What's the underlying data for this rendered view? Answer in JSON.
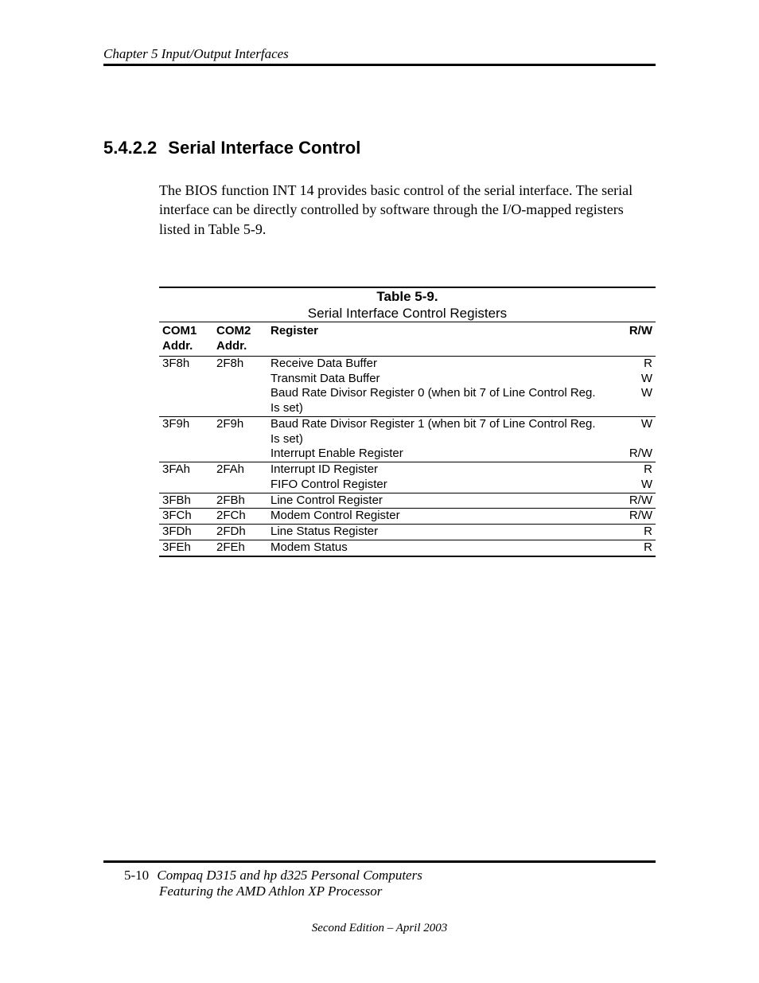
{
  "header": {
    "running": "Chapter 5  Input/Output Interfaces"
  },
  "section": {
    "number": "5.4.2.2",
    "title": "Serial Interface Control",
    "para": "The BIOS function INT 14 provides basic control of the serial interface. The serial interface can be directly controlled by software through the I/O-mapped registers listed in Table 5-9."
  },
  "table": {
    "label": "Table 5-9.",
    "caption": "Serial Interface Control Registers",
    "headers": {
      "com1": "COM1 Addr.",
      "com2": "COM2 Addr.",
      "reg": "Register",
      "rw": "R/W"
    },
    "groups": [
      {
        "com1": "3F8h",
        "com2": "2F8h",
        "rows": [
          {
            "reg": "Receive Data Buffer",
            "rw": "R"
          },
          {
            "reg": "Transmit Data Buffer",
            "rw": "W"
          },
          {
            "reg": "Baud Rate Divisor Register 0 (when bit 7 of Line Control Reg. Is set)",
            "rw": "W"
          }
        ]
      },
      {
        "com1": "3F9h",
        "com2": "2F9h",
        "rows": [
          {
            "reg": "Baud Rate Divisor Register 1 (when bit 7 of Line Control Reg. Is set)",
            "rw": "W"
          },
          {
            "reg": "Interrupt Enable Register",
            "rw": "R/W"
          }
        ]
      },
      {
        "com1": "3FAh",
        "com2": "2FAh",
        "rows": [
          {
            "reg": "Interrupt ID Register",
            "rw": "R"
          },
          {
            "reg": "FIFO Control Register",
            "rw": "W"
          }
        ]
      },
      {
        "com1": "3FBh",
        "com2": "2FBh",
        "rows": [
          {
            "reg": "Line Control Register",
            "rw": "R/W"
          }
        ]
      },
      {
        "com1": "3FCh",
        "com2": "2FCh",
        "rows": [
          {
            "reg": "Modem Control Register",
            "rw": "R/W"
          }
        ]
      },
      {
        "com1": "3FDh",
        "com2": "2FDh",
        "rows": [
          {
            "reg": "Line Status Register",
            "rw": "R"
          }
        ]
      },
      {
        "com1": "3FEh",
        "com2": "2FEh",
        "rows": [
          {
            "reg": "Modem Status",
            "rw": "R"
          }
        ]
      }
    ]
  },
  "footer": {
    "pageno": "5-10",
    "title1": "Compaq D315 and hp d325 Personal Computers",
    "title2": "Featuring the AMD Athlon XP Processor",
    "edition": "Second Edition – April 2003"
  }
}
